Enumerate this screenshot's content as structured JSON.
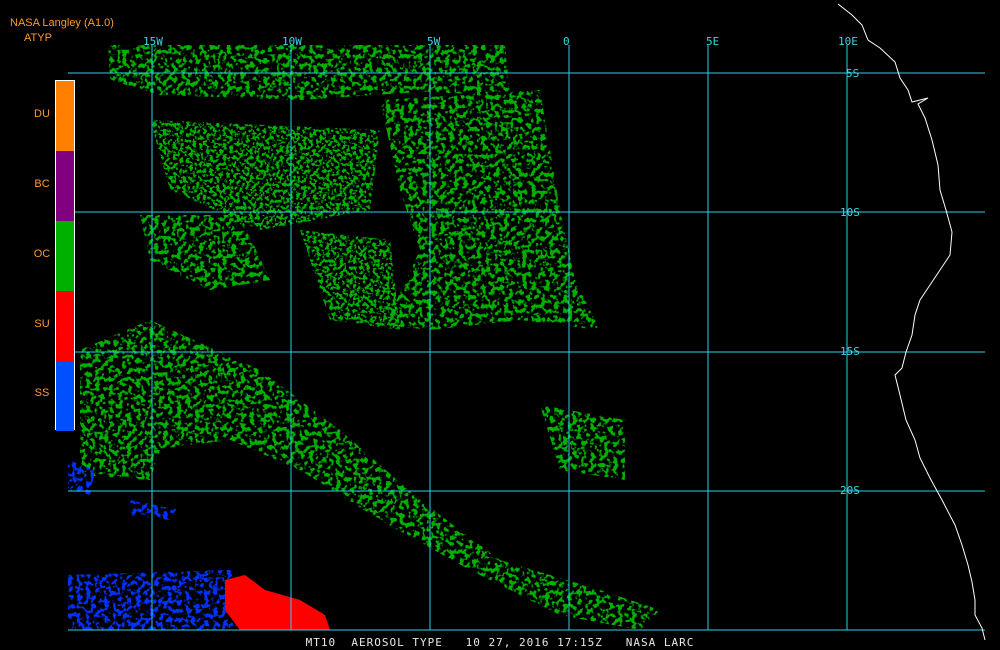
{
  "header": {
    "source": "NASA Langley (A1.0)",
    "product": "ATYP"
  },
  "footer": {
    "caption": "MT10  AEROSOL TYPE   10 27, 2016 17:15Z   NASA LARC"
  },
  "grid": {
    "longitudes": [
      "15W",
      "10W",
      "5W",
      "0",
      "5E",
      "10E"
    ],
    "latitudes": [
      "5S",
      "10S",
      "15S",
      "20S"
    ]
  },
  "legend": {
    "items": [
      {
        "code": "DU",
        "color": "#ff8000"
      },
      {
        "code": "BC",
        "color": "#800080"
      },
      {
        "code": "OC",
        "color": "#00b000"
      },
      {
        "code": "SU",
        "color": "#ff0000"
      },
      {
        "code": "SS",
        "color": "#0050ff"
      }
    ]
  },
  "colors": {
    "grid": "#2fd0e6",
    "coast": "#ffffff",
    "background": "#000000"
  }
}
